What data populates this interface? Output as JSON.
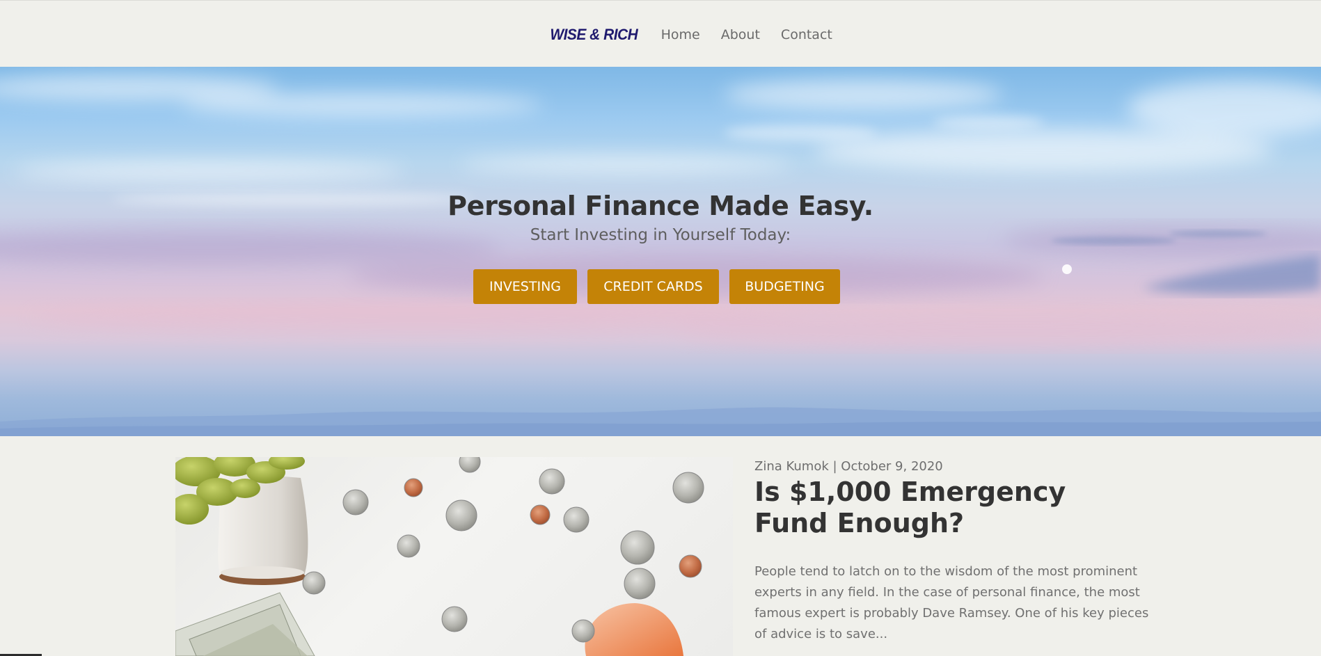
{
  "header": {
    "logo": "WISE & RICH",
    "nav": [
      {
        "label": "Home"
      },
      {
        "label": "About"
      },
      {
        "label": "Contact"
      }
    ]
  },
  "hero": {
    "title": "Personal Finance Made Easy.",
    "subtitle": "Start Investing in Yourself Today:",
    "buttons": [
      {
        "label": "INVESTING"
      },
      {
        "label": "CREDIT CARDS"
      },
      {
        "label": "BUDGETING"
      }
    ],
    "button_color": "#c48307"
  },
  "article": {
    "meta": "Zina Kumok | October 9, 2020",
    "title": "Is $1,000 Emergency Fund Enough?",
    "excerpt": "People tend to latch on to the wisdom of the most prominent experts in any field. In the case of personal finance, the most famous expert is probably Dave Ramsey. One of his key pieces of advice is to save..."
  },
  "colors": {
    "logo": "#1f1a6e",
    "background": "#f0f0eb",
    "text": "#333333"
  }
}
